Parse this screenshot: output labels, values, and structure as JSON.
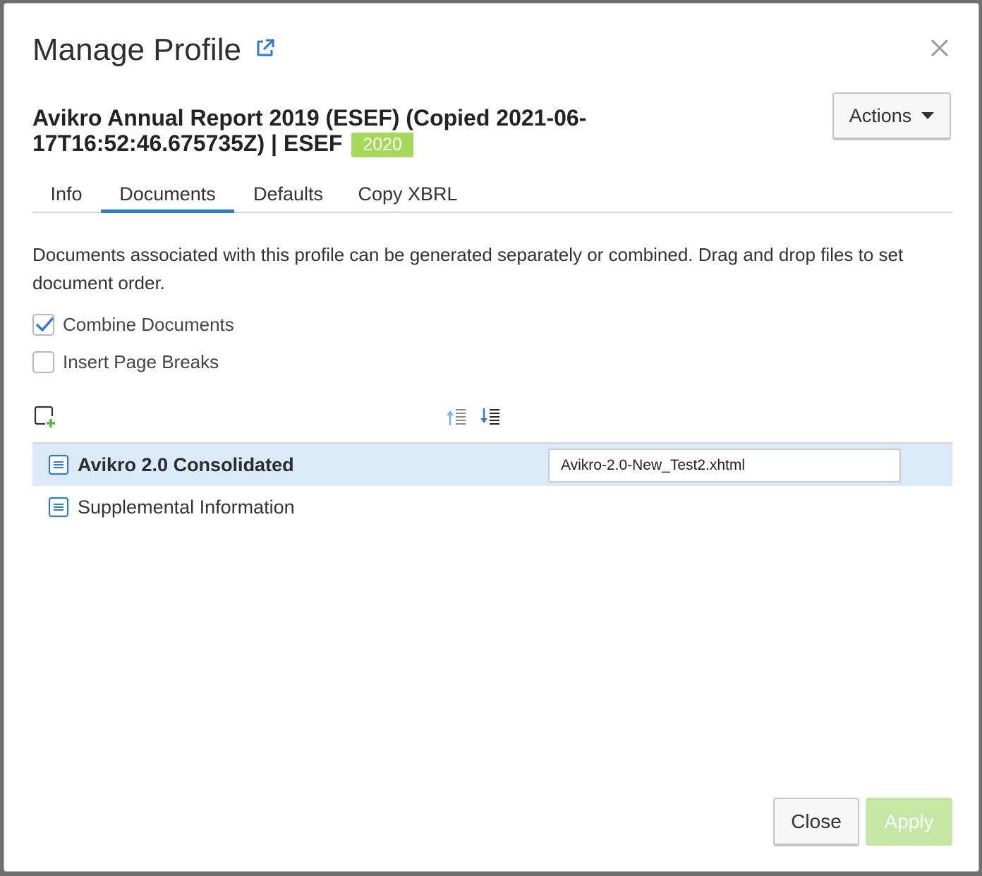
{
  "dialog": {
    "title": "Manage Profile",
    "profile_name": "Avikro Annual Report 2019 (ESEF) (Copied 2021-06-17T16:52:46.675735Z) | ESEF",
    "year_badge": "2020",
    "actions_label": "Actions"
  },
  "tabs": [
    {
      "label": "Info",
      "active": false
    },
    {
      "label": "Documents",
      "active": true
    },
    {
      "label": "Defaults",
      "active": false
    },
    {
      "label": "Copy XBRL",
      "active": false
    }
  ],
  "documents_tab": {
    "description": "Documents associated with this profile can be generated separately or combined. Drag and drop files to set document order.",
    "combine_documents": {
      "label": "Combine Documents",
      "checked": true
    },
    "insert_page_breaks": {
      "label": "Insert Page Breaks",
      "checked": false
    },
    "documents": [
      {
        "name": "Avikro 2.0 Consolidated",
        "selected": true,
        "filename": "Avikro-2.0-New_Test2.xhtml"
      },
      {
        "name": "Supplemental Information",
        "selected": false
      }
    ]
  },
  "footer": {
    "close_label": "Close",
    "apply_label": "Apply",
    "apply_enabled": false
  },
  "colors": {
    "accent": "#2f7bd6",
    "badge": "#a6d95a",
    "selected_row": "#dbeaf8",
    "apply_disabled": "#c5e7a6"
  },
  "icons": [
    "external-link-icon",
    "close-icon",
    "add-document-icon",
    "move-up-icon",
    "move-down-icon",
    "document-icon",
    "checkmark-icon",
    "caret-down-icon"
  ]
}
